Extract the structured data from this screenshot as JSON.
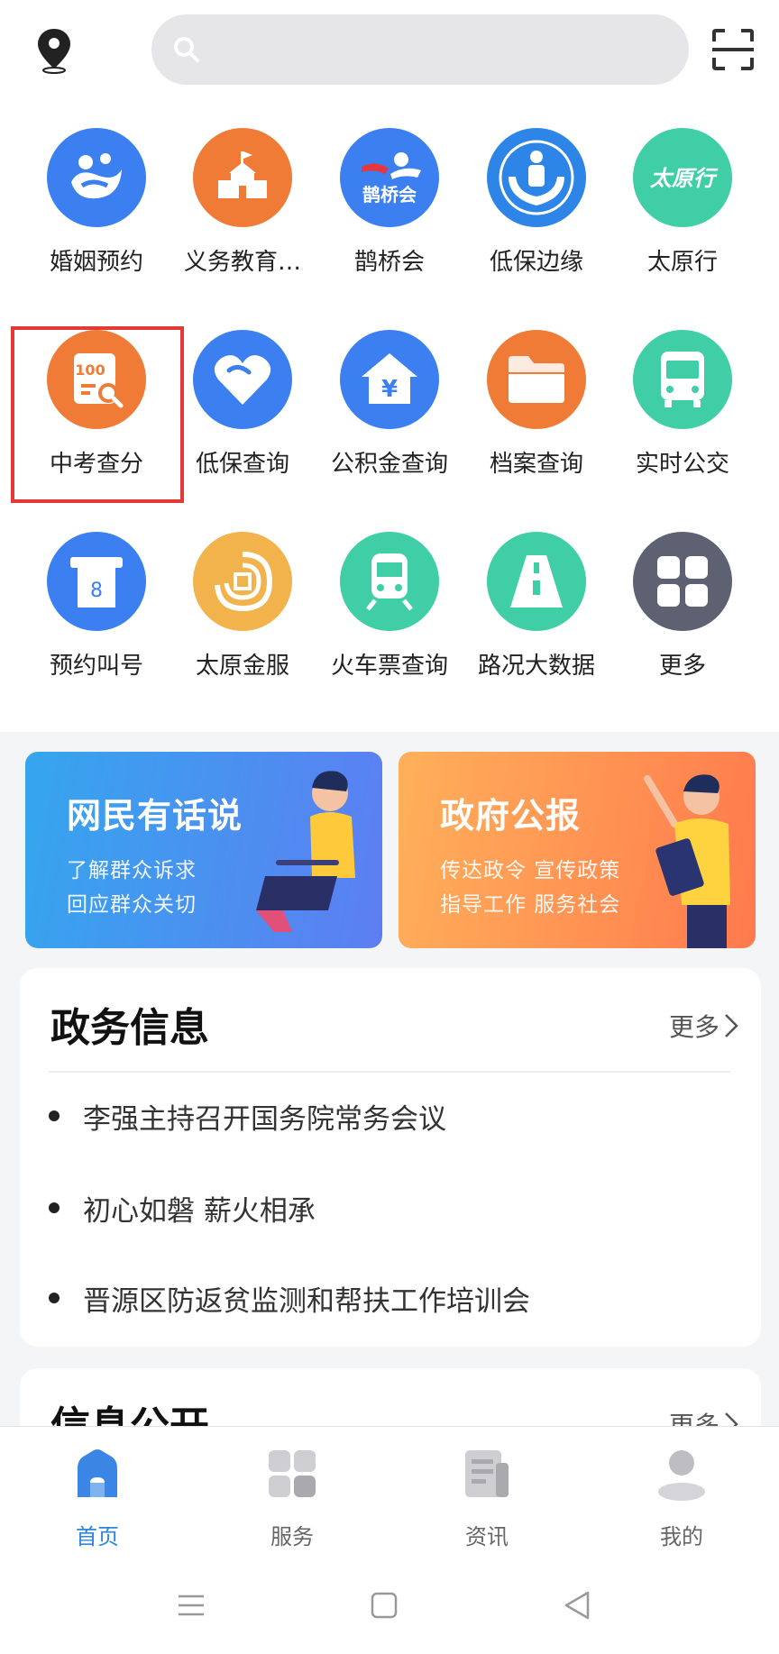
{
  "search": {
    "placeholder": ""
  },
  "grid": [
    {
      "label": "婚姻预约",
      "icon": "marriage-icon",
      "color": "#3b7ff0"
    },
    {
      "label": "义务教育…",
      "icon": "school-icon",
      "color": "#f07b36"
    },
    {
      "label": "鹊桥会",
      "icon": "magpie-bridge-icon",
      "color": "#3b7ff0",
      "icon_text": "鹊桥会"
    },
    {
      "label": "低保边缘",
      "icon": "family-care-icon",
      "color": "#2e85e8"
    },
    {
      "label": "太原行",
      "icon": "taiyuan-travel-icon",
      "color": "#3fcea5",
      "icon_text": "太原行"
    },
    {
      "label": "中考查分",
      "icon": "exam-score-icon",
      "color": "#f07b36",
      "icon_text": "100"
    },
    {
      "label": "低保查询",
      "icon": "heart-icon",
      "color": "#3b7ff0"
    },
    {
      "label": "公积金查询",
      "icon": "housing-fund-icon",
      "color": "#3b7ff0",
      "icon_text": "¥"
    },
    {
      "label": "档案查询",
      "icon": "folder-icon",
      "color": "#f07b36"
    },
    {
      "label": "实时公交",
      "icon": "bus-icon",
      "color": "#3fcea5"
    },
    {
      "label": "预约叫号",
      "icon": "queue-ticket-icon",
      "color": "#3b7ff0",
      "icon_text": "8"
    },
    {
      "label": "太原金服",
      "icon": "finance-icon",
      "color": "#f2b24c"
    },
    {
      "label": "火车票查询",
      "icon": "train-icon",
      "color": "#3fcea5"
    },
    {
      "label": "路况大数据",
      "icon": "road-icon",
      "color": "#3fcea5"
    },
    {
      "label": "更多",
      "icon": "more-apps-icon",
      "color": "#5d6171"
    }
  ],
  "banners": [
    {
      "title": "网民有话说",
      "line1": "了解群众诉求",
      "line2": "回应群众关切"
    },
    {
      "title": "政府公报",
      "line1": "传达政令  宣传政策",
      "line2": "指导工作  服务社会"
    }
  ],
  "gov_info": {
    "title": "政务信息",
    "more": "更多",
    "items": [
      "李强主持召开国务院常务会议",
      "初心如磐  薪火相承",
      "晋源区防返贫监测和帮扶工作培训会"
    ]
  },
  "info_public": {
    "title": "信息公开",
    "more": "更多"
  },
  "tabs": [
    {
      "label": "首页",
      "active": true
    },
    {
      "label": "服务",
      "active": false
    },
    {
      "label": "资讯",
      "active": false
    },
    {
      "label": "我的",
      "active": false
    }
  ]
}
